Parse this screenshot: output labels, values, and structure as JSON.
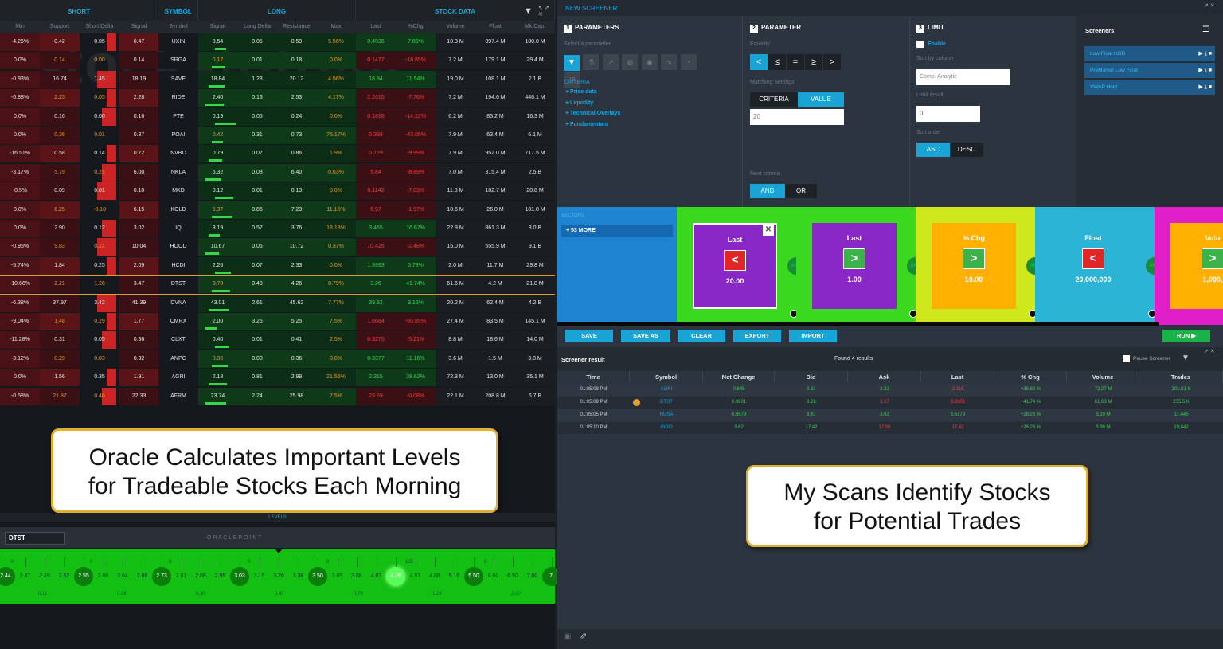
{
  "left": {
    "watermark": "stockstotrade",
    "groups": {
      "short": "SHORT",
      "symbol": "SYMBOL",
      "long": "LONG",
      "stock_data": "STOCK DATA"
    },
    "columns": [
      "Min",
      "Support",
      "Short Delta",
      "Signal",
      "Symbol",
      "Signal",
      "Long Delta",
      "Resistance",
      "Max",
      "Last",
      "%Chg",
      "Volume",
      "Float",
      "Mk.Cap."
    ],
    "rows": [
      [
        "-4.26%",
        "0.42",
        "0.05",
        "0.47",
        "UXIN",
        "0.54",
        "0.05",
        "0.59",
        "5.56%",
        "0.4536",
        "7.86%",
        "10.3 M",
        "397.4 M",
        "180.0 M"
      ],
      [
        "0.0%",
        "0.14",
        "0.00",
        "0.14",
        "SRGA",
        "0.17",
        "0.01",
        "0.18",
        "0.0%",
        "0.1477",
        "-18.85%",
        "7.2 M",
        "179.1 M",
        "29.4 M"
      ],
      [
        "-0.93%",
        "16.74",
        "1.45",
        "18.19",
        "SAVE",
        "18.84",
        "1.28",
        "20.12",
        "4.56%",
        "18.94",
        "11.54%",
        "19.0 M",
        "108.1 M",
        "2.1 B"
      ],
      [
        "-0.88%",
        "2.23",
        "0.05",
        "2.28",
        "RIDE",
        "2.40",
        "0.13",
        "2.53",
        "4.17%",
        "2.2615",
        "-7.76%",
        "7.2 M",
        "194.6 M",
        "446.1 M"
      ],
      [
        "0.0%",
        "0.16",
        "0.00",
        "0.16",
        "PTE",
        "0.19",
        "0.05",
        "0.24",
        "0.0%",
        "0.1818",
        "-14.12%",
        "6.2 M",
        "85.2 M",
        "16.3 M"
      ],
      [
        "0.0%",
        "0.36",
        "0.01",
        "0.37",
        "POAI",
        "0.42",
        "0.31",
        "0.73",
        "76.17%",
        "0.398",
        "-43.05%",
        "7.9 M",
        "63.4 M",
        "6.1 M"
      ],
      [
        "-16.51%",
        "0.58",
        "0.14",
        "0.72",
        "NVBO",
        "0.79",
        "0.07",
        "0.86",
        "1.9%",
        "0.729",
        "-9.99%",
        "7.9 M",
        "952.0 M",
        "717.5 M"
      ],
      [
        "-3.17%",
        "5.79",
        "0.21",
        "6.00",
        "NKLA",
        "6.32",
        "0.08",
        "6.40",
        "0.63%",
        "5.84",
        "-8.89%",
        "7.0 M",
        "315.4 M",
        "2.5 B"
      ],
      [
        "-0.5%",
        "0.09",
        "0.01",
        "0.10",
        "MKD",
        "0.12",
        "0.01",
        "0.13",
        "0.0%",
        "0.1142",
        "-7.03%",
        "11.8 M",
        "182.7 M",
        "20.8 M"
      ],
      [
        "0.0%",
        "6.25",
        "-0.10",
        "6.15",
        "KOLD",
        "6.37",
        "0.86",
        "7.23",
        "11.15%",
        "6.97",
        "-1.97%",
        "10.6 M",
        "26.0 M",
        "181.0 M"
      ],
      [
        "0.0%",
        "2.90",
        "0.12",
        "3.02",
        "IQ",
        "3.19",
        "0.57",
        "3.76",
        "18.18%",
        "3.465",
        "16.67%",
        "22.9 M",
        "861.3 M",
        "3.0 B"
      ],
      [
        "-0.95%",
        "9.83",
        "0.21",
        "10.04",
        "HOOD",
        "10.67",
        "0.05",
        "10.72",
        "0.37%",
        "10.425",
        "-2.48%",
        "15.0 M",
        "555.9 M",
        "9.1 B"
      ],
      [
        "-5.74%",
        "1.84",
        "0.25",
        "2.09",
        "HCDI",
        "2.26",
        "0.07",
        "2.33",
        "0.0%",
        "1.9993",
        "5.78%",
        "2.0 M",
        "11.7 M",
        "29.8 M"
      ],
      [
        "-10.66%",
        "2.21",
        "1.26",
        "3.47",
        "DTST",
        "3.78",
        "0.48",
        "4.26",
        "0.79%",
        "3.26",
        "41.74%",
        "61.6 M",
        "4.2 M",
        "21.8 M"
      ],
      [
        "-6.38%",
        "37.97",
        "3.42",
        "41.39",
        "CVNA",
        "43.01",
        "2.61",
        "45.62",
        "7.77%",
        "39.52",
        "3.16%",
        "20.2 M",
        "62.4 M",
        "4.2 B"
      ],
      [
        "-9.04%",
        "1.48",
        "0.29",
        "1.77",
        "CMRX",
        "2.00",
        "3.25",
        "5.25",
        "7.5%",
        "1.6684",
        "-60.85%",
        "27.4 M",
        "83.5 M",
        "145.1 M"
      ],
      [
        "-11.28%",
        "0.31",
        "0.05",
        "0.36",
        "CLXT",
        "0.40",
        "0.01",
        "0.41",
        "2.5%",
        "0.3275",
        "-5.21%",
        "8.8 M",
        "18.6 M",
        "14.0 M"
      ],
      [
        "-3.12%",
        "0.29",
        "0.03",
        "0.32",
        "ANPC",
        "0.36",
        "0.00",
        "0.36",
        "0.0%",
        "0.3377",
        "11.16%",
        "3.6 M",
        "1.5 M",
        "3.8 M"
      ],
      [
        "0.0%",
        "1.56",
        "0.35",
        "1.91",
        "AGRI",
        "2.18",
        "0.81",
        "2.99",
        "21.56%",
        "2.315",
        "38.62%",
        "72.3 M",
        "13.0 M",
        "35.1 M"
      ],
      [
        "-0.58%",
        "21.87",
        "0.46",
        "22.33",
        "AFRM",
        "23.74",
        "2.24",
        "25.98",
        "7.5%",
        "23.69",
        "-0.08%",
        "22.1 M",
        "208.8 M",
        "6.7 B"
      ]
    ],
    "callout": "Oracle Calculates Important Levels\nfor Tradeable Stocks Each Morning",
    "levels_label": "LEVELS",
    "oracle_symbol": "DTST",
    "oracle_title": "O R A C L E      P O I N T",
    "oracle_levels": [
      "2.44",
      "2.47",
      "2.49",
      "2.52",
      "2.55",
      "2.60",
      "2.64",
      "2.68",
      "2.73",
      "2.81",
      "2.88",
      "2.95",
      "3.03",
      "3.15",
      "3.26",
      "3.38",
      "3.50",
      "3.69",
      "3.88",
      "4.07",
      "4.26",
      "4.57",
      "4.88",
      "5.19",
      "5.50",
      "6.00",
      "6.50",
      "7.00",
      "7."
    ],
    "oracle_top": [
      "0",
      "0",
      "0",
      "0",
      "0",
      "125",
      "0",
      "0"
    ],
    "oracle_bottom": [
      "0.11",
      "0.18",
      "0.30",
      "0.47",
      "0.76",
      "1.24",
      "2.00"
    ]
  },
  "right": {
    "title": "NEW SCREENER",
    "parameters": {
      "num": "1",
      "title": "PARAMETERS",
      "hint": "Select a parameter",
      "criteria_label": "CRITERIA",
      "criteria": [
        "Price data",
        "Liquidity",
        "Technical Overlays",
        "Fundamentals"
      ]
    },
    "parameter": {
      "num": "2",
      "title": "PARAMETER",
      "equality_label": "Equality",
      "ops": [
        "<",
        "≤",
        "=",
        "≥",
        ">"
      ],
      "matching_label": "Matching Settings",
      "criteria_btn": "CRITERIA",
      "value_btn": "VALUE",
      "value": "20",
      "next_label": "Next criteria",
      "and": "AND",
      "or": "OR"
    },
    "limit": {
      "num": "3",
      "title": "LIMIT",
      "enable": "Enable",
      "sort_col_label": "Sort by column",
      "sort_col": "Comp. Analytic",
      "limit_label": "Limit result",
      "limit_value": "0",
      "order_label": "Sort order",
      "asc": "ASC",
      "desc": "DESC"
    },
    "screeners": {
      "title": "Screeners",
      "items": [
        "Low Float HOD",
        "PreMarket Low Float",
        "VWAP Hold"
      ]
    },
    "sectors_label": "SECTORS",
    "more": "+ 53 MORE",
    "cards": [
      {
        "name": "Last",
        "op": "<",
        "value": "20.00",
        "color": "#8a27c7",
        "bg": "#3ad81e",
        "opc": "#e02626"
      },
      {
        "name": "Last",
        "op": ">",
        "value": "1.00",
        "color": "#8a27c7",
        "bg": "#3ad81e",
        "opc": "#3bb34a"
      },
      {
        "name": "% Chg",
        "op": ">",
        "value": "10.00",
        "color": "#ffb000",
        "bg": "#cfe81e",
        "opc": "#3bb34a"
      },
      {
        "name": "Float",
        "op": "<",
        "value": "20,000,000",
        "color": "#2cb4d6",
        "bg": "#2cb4d6",
        "opc": "#e02626"
      },
      {
        "name": "Volu",
        "op": ">",
        "value": "1,000,",
        "color": "#ffb000",
        "bg": "#e11fc8",
        "opc": "#3bb34a"
      }
    ],
    "and_label": "AND",
    "buttons": {
      "save": "SAVE",
      "saveas": "SAVE AS",
      "clear": "CLEAR",
      "export": "EXPORT",
      "import": "IMPORT",
      "run": "RUN"
    },
    "result": {
      "title": "Screener result",
      "found": "Found 4 results",
      "pause": "Pause Screener",
      "cols": [
        "Time",
        "Symbol",
        "Net Change",
        "Bid",
        "Ask",
        "Last",
        "% Chg",
        "Volume",
        "Trades"
      ],
      "rows": [
        [
          "01:05:08 PM",
          "AGRI",
          "0.645",
          "2.31",
          "2.32",
          "2.315",
          "+38.62 %",
          "72.27 M",
          "201.01 K"
        ],
        [
          "01:05:09 PM",
          "DTST",
          "0.9601",
          "3.26",
          "3.27",
          "3.2601",
          "+41.74 %",
          "61.63 M",
          "255.5 K"
        ],
        [
          "01:05:05 PM",
          "HUSA",
          "0.5579",
          "3.61",
          "3.62",
          "3.6179",
          "+18.23 %",
          "5.19 M",
          "11,445"
        ],
        [
          "01:05:10 PM",
          "INDO",
          "3.62",
          "17.42",
          "17.58",
          "17.42",
          "+26.23 %",
          "3.99 M",
          "19,842"
        ]
      ]
    },
    "callout": "My Scans Identify Stocks\nfor Potential Trades"
  },
  "colors": {
    "accent": "#1aa4d6",
    "green": "#10b810",
    "red": "#e02626",
    "orange": "#e0a030"
  }
}
